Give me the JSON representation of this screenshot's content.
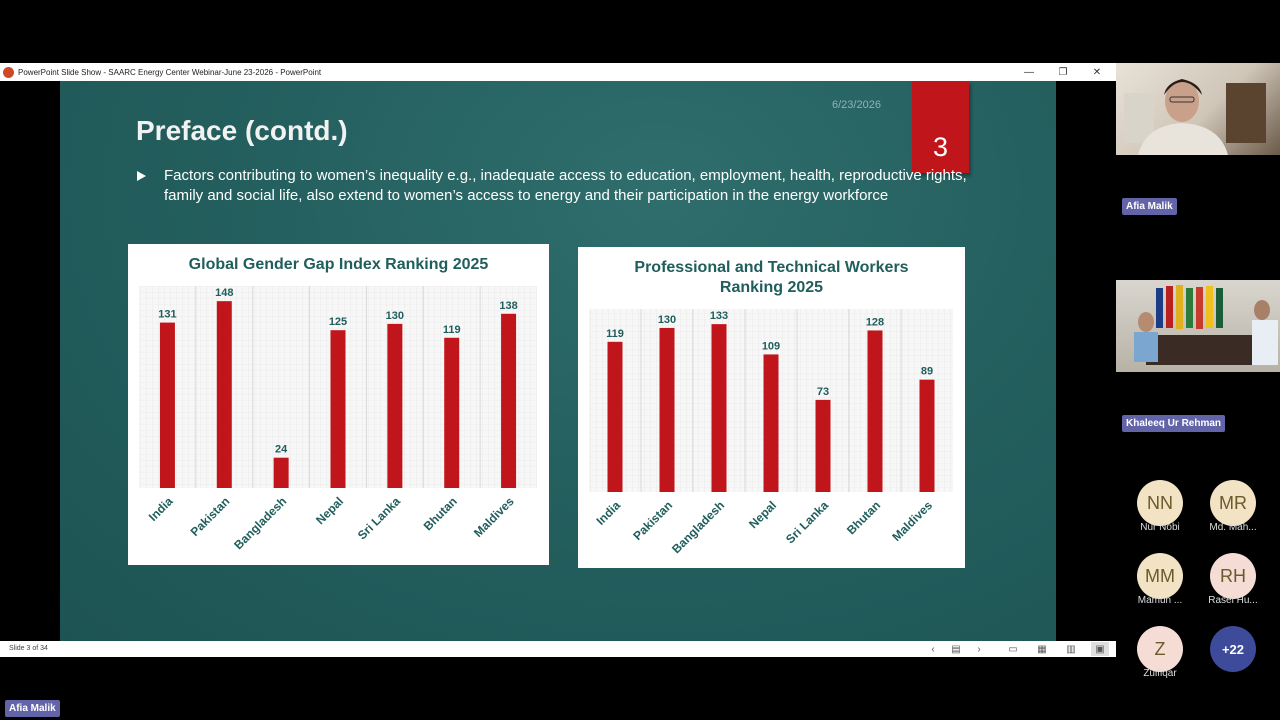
{
  "window": {
    "title": "PowerPoint Slide Show  -  SAARC Energy Center Webinar-June 23-2026 - PowerPoint",
    "controls": {
      "minimize": "—",
      "restore": "❐",
      "close": "✕"
    }
  },
  "slide": {
    "date": "6/23/2026",
    "number": "3",
    "title": "Preface (contd.)",
    "bullet": "Factors contributing to women’s inequality e.g., inadequate access to education, employment, health, reproductive rights, family and social life, also extend to women’s access to energy and their participation in the energy workforce"
  },
  "chart_data": [
    {
      "type": "bar",
      "title": "Global Gender Gap Index Ranking 2025",
      "categories": [
        "India",
        "Pakistan",
        "Bangladesh",
        "Nepal",
        "Sri Lanka",
        "Bhutan",
        "Maldives"
      ],
      "values": [
        131,
        148,
        24,
        125,
        130,
        119,
        138
      ],
      "ylim": [
        0,
        160
      ],
      "bar_color": "#c0161b",
      "label_color": "#1f5e5c",
      "grid": true
    },
    {
      "type": "bar",
      "title": "Professional and Technical Workers Ranking 2025",
      "categories": [
        "India",
        "Pakistan",
        "Bangladesh",
        "Nepal",
        "Sri Lanka",
        "Bhutan",
        "Maldives"
      ],
      "values": [
        119,
        130,
        133,
        109,
        73,
        128,
        89
      ],
      "ylim": [
        0,
        145
      ],
      "bar_color": "#c0161b",
      "label_color": "#1f5e5c",
      "grid": true
    }
  ],
  "statusbar": {
    "slide_counter": "Slide 3 of 34",
    "icons": [
      "prev-icon",
      "slide-list-icon",
      "next-icon",
      "normal-view-icon",
      "slide-sorter-icon",
      "reading-view-icon",
      "slideshow-icon"
    ]
  },
  "participants": {
    "speaker_name": "Afia Malik",
    "room_name": "Khaleeq Ur Rehman",
    "avatars": [
      {
        "initials": "NN",
        "name": "Nur Nobi",
        "color": "#f1e3c4"
      },
      {
        "initials": "MR",
        "name": "Md. Mah...",
        "color": "#f1e3c4"
      },
      {
        "initials": "MM",
        "name": "Mamun ...",
        "color": "#f1e3c4"
      },
      {
        "initials": "RH",
        "name": "Rasel Hu...",
        "color": "#f5ddd6"
      },
      {
        "initials": "Z",
        "name": "Zulfiqar",
        "color": "#f5ddd6"
      }
    ],
    "overflow_label": "+22",
    "overflow_color": "#3e4a9a"
  },
  "presenter_tag": "Afia Malik"
}
